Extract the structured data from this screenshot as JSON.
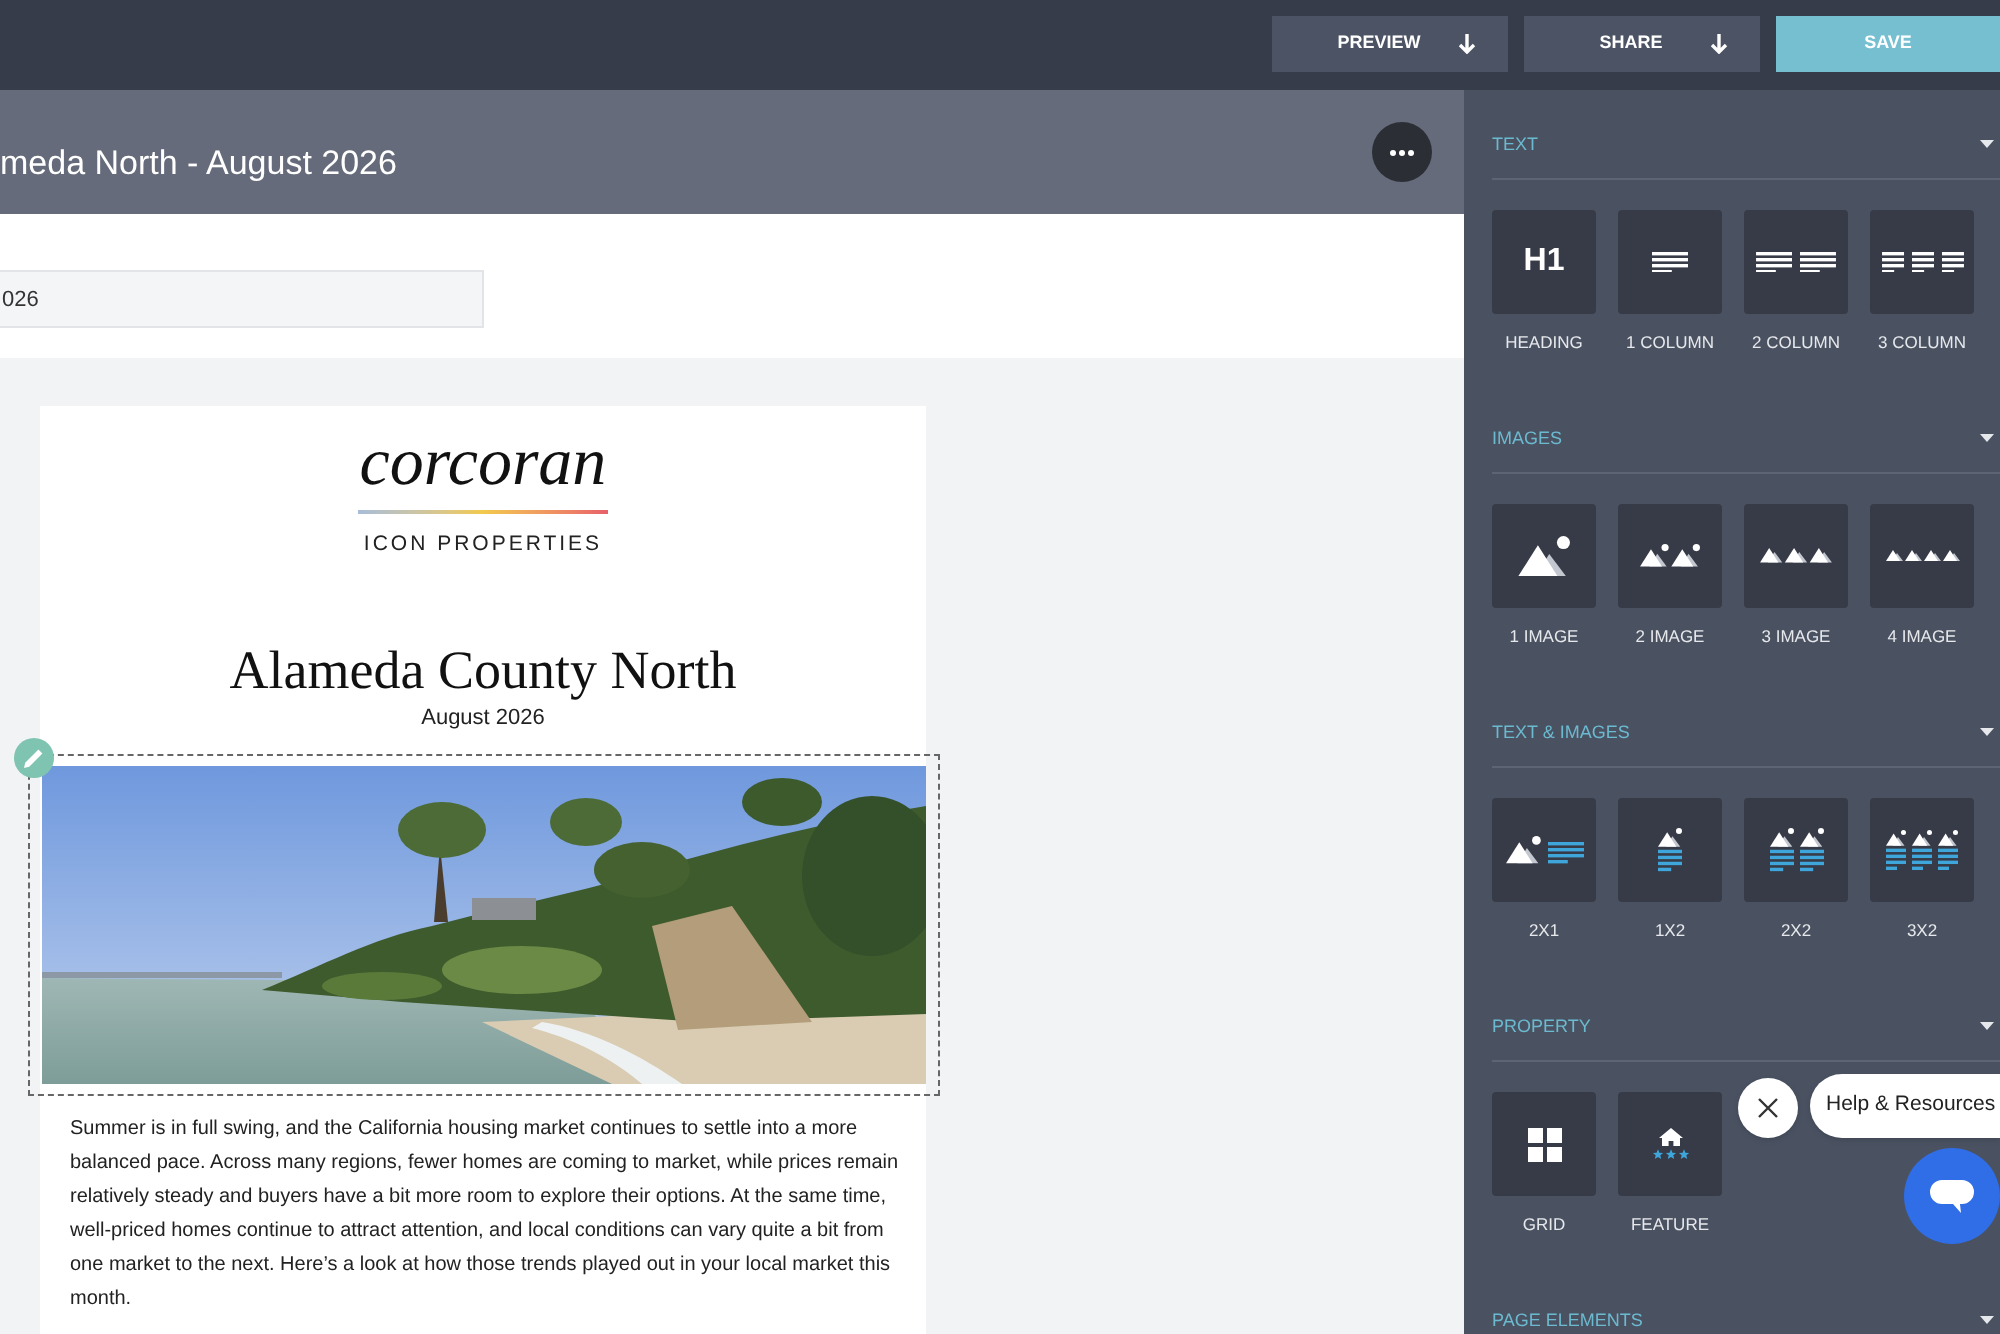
{
  "toolbar": {
    "buttons": [
      {
        "label": "PREVIEW",
        "kind": "dropdown"
      },
      {
        "label": "SHARE",
        "kind": "dropdown"
      },
      {
        "label": "SAVE",
        "kind": "primary"
      }
    ]
  },
  "editor": {
    "title": "meda North - August 2026",
    "name_field": {
      "value": "026"
    }
  },
  "newsletter": {
    "logo": {
      "wordmark": "corcoran",
      "tagline": "ICON PROPERTIES"
    },
    "heading": "Alameda County North",
    "date": "August 2026",
    "body": "Summer is in full swing, and the California housing market continues to settle into a more balanced pace. Across many regions, fewer homes are coming to market, while prices remain relatively steady and buyers have a bit more room to explore their options. At the same time, well-priced homes continue to attract attention, and local conditions can vary quite a bit from one market to the next. Here’s a look at how those trends played out in your local market this month."
  },
  "blocks_panel": {
    "sections": [
      {
        "title": "TEXT",
        "blocks": [
          {
            "kind": "heading",
            "icon_text": "H1",
            "label": "HEADING"
          },
          {
            "kind": "text-1",
            "label": "1 COLUMN"
          },
          {
            "kind": "text-2",
            "label": "2 COLUMN"
          },
          {
            "kind": "text-3",
            "label": "3 COLUMN"
          }
        ]
      },
      {
        "title": "IMAGES",
        "blocks": [
          {
            "kind": "image-1",
            "label": "1 IMAGE"
          },
          {
            "kind": "image-2",
            "label": "2 IMAGE"
          },
          {
            "kind": "image-3",
            "label": "3 IMAGE"
          },
          {
            "kind": "image-4",
            "label": "4 IMAGE"
          }
        ]
      },
      {
        "title": "TEXT & IMAGES",
        "blocks": [
          {
            "kind": "image-text-2x1",
            "label": "2X1"
          },
          {
            "kind": "image-text-1x2",
            "label": "1X2"
          },
          {
            "kind": "image-text-2x2",
            "label": "2X2"
          },
          {
            "kind": "image-text-3x2",
            "label": "3X2"
          }
        ]
      },
      {
        "title": "PROPERTY",
        "blocks": [
          {
            "kind": "grid",
            "label": "GRID"
          },
          {
            "kind": "feature",
            "label": "FEATURE"
          }
        ]
      },
      {
        "title": "PAGE ELEMENTS"
      }
    ]
  },
  "help_widget": {
    "label": "Help & Resources"
  }
}
